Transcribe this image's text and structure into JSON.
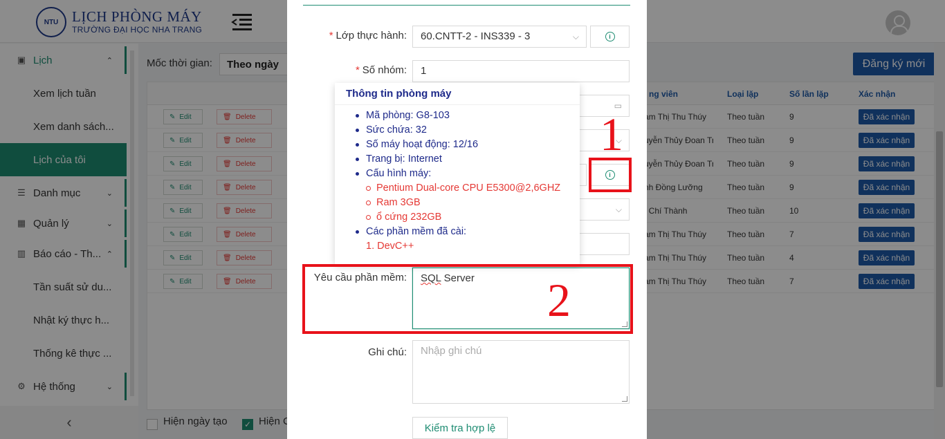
{
  "header": {
    "logo_mark": "NTU",
    "title": "LỊCH PHÒNG MÁY",
    "subtitle": "TRƯỜNG ĐẠI HỌC NHA TRANG"
  },
  "sidebar": {
    "items": [
      {
        "label": "Lịch",
        "icon": "calendar-icon",
        "arrow": "⌃"
      },
      {
        "label": "Xem lịch tuần"
      },
      {
        "label": "Xem danh sách..."
      },
      {
        "label": "Lịch của tôi"
      },
      {
        "label": "Danh mục",
        "icon": "list-icon",
        "arrow": "⌄"
      },
      {
        "label": "Quản lý",
        "icon": "grid-icon",
        "arrow": "⌄"
      },
      {
        "label": "Báo cáo - Th...",
        "icon": "bar-chart-icon",
        "arrow": "⌃"
      },
      {
        "label": "Tần suất sử du..."
      },
      {
        "label": "Nhật ký thực h..."
      },
      {
        "label": "Thống kê thực ..."
      },
      {
        "label": "Hệ thống",
        "icon": "gear-icon",
        "arrow": "⌄"
      }
    ],
    "collapse": "‹"
  },
  "main": {
    "moc_label": "Mốc thời gian:",
    "moc_value": "Theo ngày",
    "register_btn": "Đăng ký mới",
    "headers": [
      "ng viên",
      "Loại lặp",
      "Số lần lặp",
      "Xác nhận"
    ],
    "edit_label": "Edit",
    "delete_label": "Delete",
    "rows": [
      {
        "gv": "ạm Thị Thu Thúy",
        "loai": "Theo tuần",
        "so": "9",
        "xn": "Đã xác nhận"
      },
      {
        "gv": "uyễn Thủy Đoan Tr",
        "loai": "Theo tuần",
        "so": "9",
        "xn": "Đã xác nhận"
      },
      {
        "gv": "uyễn Thủy Đoan Tr",
        "loai": "Theo tuần",
        "so": "9",
        "xn": "Đã xác nhận"
      },
      {
        "gv": "nh Đồng Lưỡng",
        "loai": "Theo tuần",
        "so": "9",
        "xn": "Đã xác nhận"
      },
      {
        "gv": "í Chí Thành",
        "loai": "Theo tuần",
        "so": "10",
        "xn": "Đã xác nhận"
      },
      {
        "gv": "ạm Thị Thu Thúy",
        "loai": "Theo tuần",
        "so": "7",
        "xn": "Đã xác nhận"
      },
      {
        "gv": "ạm Thị Thu Thúy",
        "loai": "Theo tuần",
        "so": "4",
        "xn": "Đã xác nhận"
      },
      {
        "gv": "ạm Thị Thu Thúy",
        "loai": "Theo tuần",
        "so": "7",
        "xn": "Đã xác nhận"
      }
    ],
    "footer_show_created": "Hiện ngày tạo",
    "footer_show_other": "Hiện C"
  },
  "modal": {
    "lop_label": "Lớp thực hành:",
    "lop_value": "60.CNTT-2 - INS339 - 3",
    "nhom_label": "Số nhóm:",
    "nhom_value": "1",
    "yeucau_label": "Yêu cầu phần mềm:",
    "yeucau_word1": "SQL",
    "yeucau_word2": " Server",
    "ghichu_label": "Ghi chú:",
    "ghichu_placeholder": "Nhập ghi chú",
    "check_btn": "Kiểm tra hợp lệ"
  },
  "popover": {
    "title": "Thông tin phòng máy",
    "ma_phong": "Mã phòng: G8-103",
    "suc_chua": "Sức chứa: 32",
    "so_may": "Số máy hoạt động: 12/16",
    "trang_bi": "Trang bị: Internet",
    "cau_hinh": "Cấu hình máy:",
    "cpu": "Pentium Dual-core CPU E5300@2,6GHZ",
    "ram": "Ram 3GB",
    "disk": "ổ cứng 232GB",
    "phan_mem": "Các phần mềm đã cài:",
    "pm1": "1. DevC++"
  },
  "annotations": {
    "one": "1",
    "two": "2"
  },
  "colors": {
    "primary_green": "#1e8c72",
    "primary_blue": "#1e5aa8",
    "annotation_red": "#e8121a"
  }
}
